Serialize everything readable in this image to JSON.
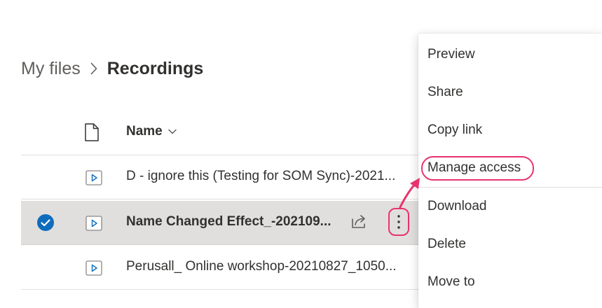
{
  "breadcrumb": {
    "root": "My files",
    "current": "Recordings"
  },
  "list": {
    "header": {
      "name_label": "Name",
      "file_type_icon": "document-icon",
      "sort_icon": "chevron-down-icon"
    },
    "rows": [
      {
        "name": "D - ignore this (Testing for SOM Sync)-2021...",
        "icon": "video-file-icon",
        "selected": false
      },
      {
        "name": "Name Changed Effect_-202109...",
        "icon": "video-file-icon",
        "selected": true
      },
      {
        "name": "Perusall_ Online workshop-20210827_1050...",
        "icon": "video-file-icon",
        "selected": false
      }
    ]
  },
  "context_menu": {
    "items": [
      {
        "label": "Preview"
      },
      {
        "label": "Share"
      },
      {
        "label": "Copy link"
      },
      {
        "label": "Manage access"
      },
      {
        "label": "Download"
      },
      {
        "label": "Delete"
      },
      {
        "label": "Move to"
      }
    ]
  },
  "colors": {
    "accent": "#0f6cbd",
    "highlight": "#e8336d",
    "selected_row_bg": "#e1dfdd",
    "divider": "#e1dfdd"
  }
}
